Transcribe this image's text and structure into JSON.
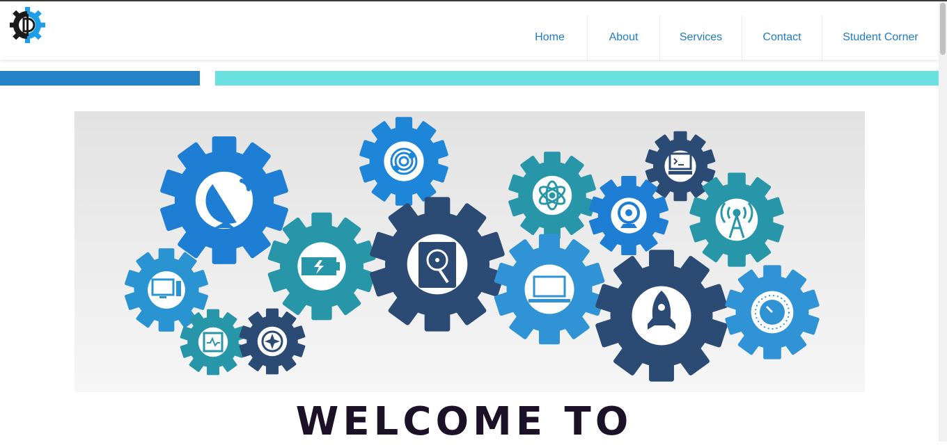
{
  "nav": {
    "items": [
      {
        "label": "Home"
      },
      {
        "label": "About"
      },
      {
        "label": "Services"
      },
      {
        "label": "Contact"
      },
      {
        "label": "Student Corner"
      }
    ]
  },
  "banner": {
    "icons": [
      "satellite-dish-icon",
      "fingerprint-icon",
      "atom-icon",
      "terminal-icon",
      "battery-icon",
      "hard-drive-icon",
      "webcam-icon",
      "antenna-icon",
      "monitor-icon",
      "laptop-icon",
      "rocket-icon",
      "processor-chip-icon",
      "compass-icon",
      "dial-knob-icon"
    ]
  },
  "hero": {
    "welcome_text": "WELCOME TO"
  },
  "colors": {
    "accent_blue": "#2383c4",
    "accent_cyan": "#6ae0e0",
    "nav_text": "#1e7bc4",
    "gear_dark_navy": "#2b4a74",
    "gear_blue": "#1d7ed4",
    "gear_teal": "#2796a9",
    "gear_light_blue": "#2f93d6"
  }
}
